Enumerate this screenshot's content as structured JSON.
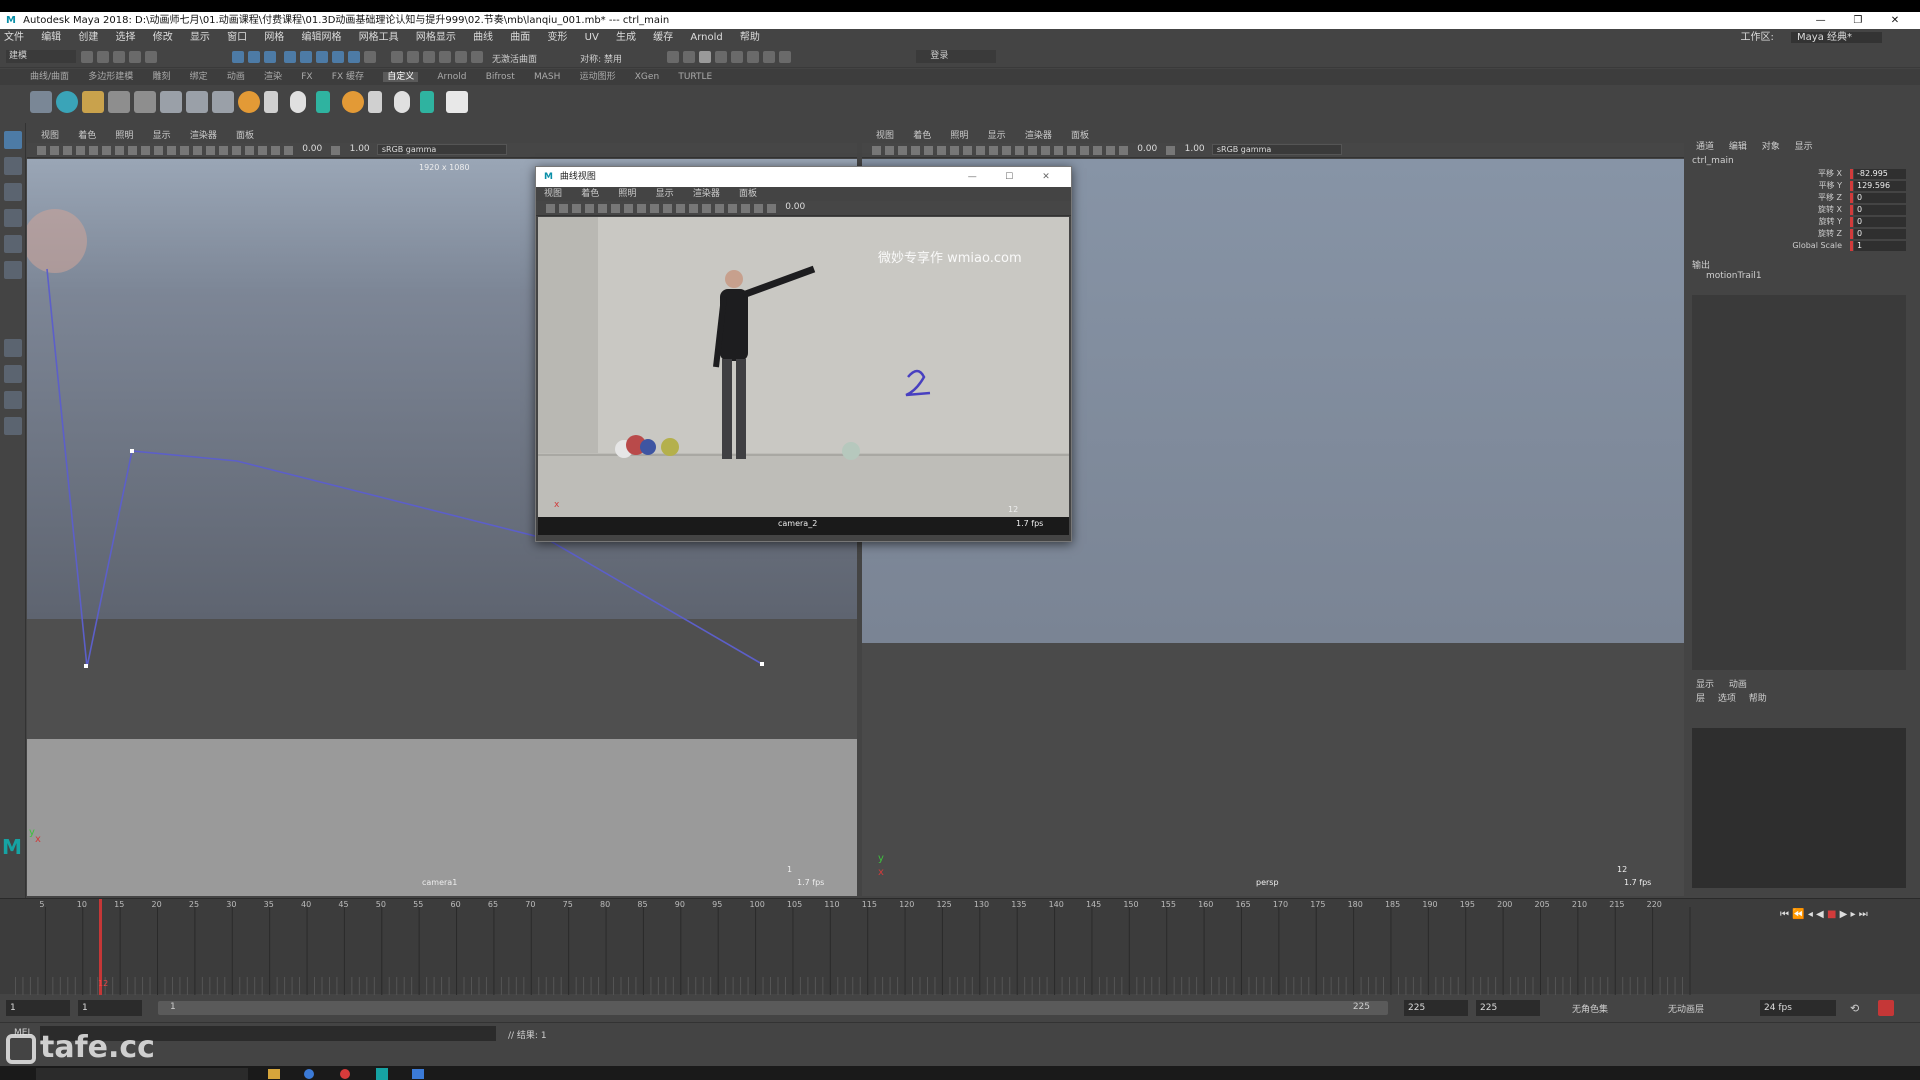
{
  "titlebar": {
    "title": "Autodesk Maya 2018: D:\\动画师七月\\01.动画课程\\付费课程\\01.3D动画基础理论认知与提升999\\02.节奏\\mb\\lanqiu_001.mb*   ---   ctrl_main"
  },
  "menubar": {
    "items": [
      "文件",
      "编辑",
      "创建",
      "选择",
      "修改",
      "显示",
      "窗口",
      "网格",
      "编辑网格",
      "网格工具",
      "网格显示",
      "曲线",
      "曲面",
      "变形",
      "UV",
      "生成",
      "缓存",
      "Arnold",
      "帮助"
    ],
    "workspace_label": "工作区:",
    "workspace_value": "Maya 经典*"
  },
  "statusline": {
    "mode": "建模",
    "symmetry": "对称: 禁用",
    "live": "无激活曲面",
    "login": "登录"
  },
  "shelf_tabs": [
    "曲线/曲面",
    "多边形建模",
    "雕刻",
    "绑定",
    "动画",
    "渲染",
    "FX",
    "FX 缓存",
    "自定义",
    "Arnold",
    "Bifrost",
    "MASH",
    "运动图形",
    "XGen",
    "TURTLE"
  ],
  "shelf_active_tab": "自定义",
  "viewport_menu": [
    "视图",
    "着色",
    "照明",
    "显示",
    "渲染器",
    "面板"
  ],
  "viewport_toolbar": {
    "value_a": "0.00",
    "value_b": "1.00",
    "gamma": "sRGB gamma"
  },
  "left_viewport": {
    "resolution": "1920 x 1080",
    "camera": "camera1",
    "fps": "1.7 fps",
    "frame": "1"
  },
  "right_viewport": {
    "camera": "persp",
    "fps": "1.7 fps",
    "frame": "12"
  },
  "dialog": {
    "title": "曲线视图",
    "menu": [
      "视图",
      "着色",
      "照明",
      "显示",
      "渲染器",
      "面板"
    ],
    "value": "0.00",
    "video_watermark": "微妙专享作 wmiao.com",
    "annotation": "2",
    "camera": "camera_2",
    "fps": "1.7 fps",
    "frame": "12"
  },
  "channel_box": {
    "tabs": [
      "通道",
      "编辑",
      "对象",
      "显示"
    ],
    "object": "ctrl_main",
    "attributes": [
      {
        "label": "平移 X",
        "value": "-82.995"
      },
      {
        "label": "平移 Y",
        "value": "129.596"
      },
      {
        "label": "平移 Z",
        "value": "0"
      },
      {
        "label": "旋转 X",
        "value": "0"
      },
      {
        "label": "旋转 Y",
        "value": "0"
      },
      {
        "label": "旋转 Z",
        "value": "0"
      },
      {
        "label": "Global Scale",
        "value": "1"
      }
    ],
    "outputs_label": "输出",
    "output_node": "motionTrail1"
  },
  "layer_editor": {
    "tabs": [
      "显示",
      "动画"
    ],
    "menu": [
      "层",
      "选项",
      "帮助"
    ]
  },
  "timeline": {
    "ticks": [
      "5",
      "10",
      "15",
      "20",
      "25",
      "30",
      "35",
      "40",
      "45",
      "50",
      "55",
      "60",
      "65",
      "70",
      "75",
      "80",
      "85",
      "90",
      "95",
      "100",
      "105",
      "110",
      "115",
      "120",
      "125",
      "130",
      "135",
      "140",
      "145",
      "150",
      "155",
      "160",
      "165",
      "170",
      "175",
      "180",
      "185",
      "190",
      "195",
      "200",
      "205",
      "210",
      "215",
      "220"
    ],
    "current_frame": "12",
    "end": "225"
  },
  "range": {
    "start_a": "1",
    "start_b": "1",
    "slider_start": "1",
    "slider_end": "225",
    "end_a": "225",
    "end_b": "225",
    "char_set": "无角色集",
    "anim_layer": "无动画层",
    "fps": "24 fps"
  },
  "cmdline": {
    "mel": "MEL",
    "result": "// 结果: 1"
  },
  "watermark": "tafe.cc",
  "colors": {
    "sky": "#8a98ab",
    "ground": "#5a5a5a",
    "accent_red": "#d13b3b",
    "curve_blue": "#5c5fc9"
  }
}
